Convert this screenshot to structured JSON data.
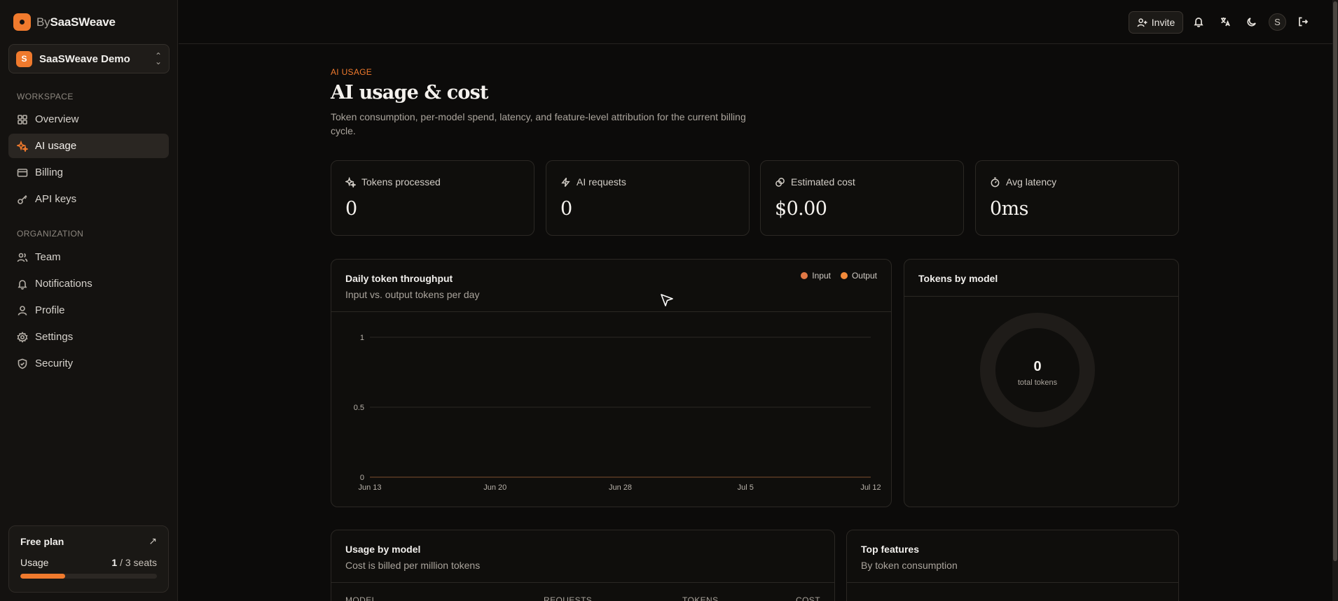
{
  "brand": {
    "prefix": "By",
    "name": "SaaSWeave"
  },
  "workspace": {
    "initial": "S",
    "name": "SaaSWeave Demo"
  },
  "sidebar": {
    "workspace_heading": "WORKSPACE",
    "workspace_items": [
      {
        "label": "Overview",
        "icon": "grid-icon"
      },
      {
        "label": "AI usage",
        "icon": "sparkles-icon",
        "active": true
      },
      {
        "label": "Billing",
        "icon": "credit-card-icon"
      },
      {
        "label": "API keys",
        "icon": "key-icon"
      }
    ],
    "org_heading": "ORGANIZATION",
    "org_items": [
      {
        "label": "Team",
        "icon": "users-icon"
      },
      {
        "label": "Notifications",
        "icon": "bell-icon"
      },
      {
        "label": "Profile",
        "icon": "user-icon"
      },
      {
        "label": "Settings",
        "icon": "gear-icon"
      },
      {
        "label": "Security",
        "icon": "shield-icon"
      }
    ]
  },
  "plan": {
    "title": "Free plan",
    "usage_label": "Usage",
    "seats_used": "1",
    "seats_total": " / 3 seats",
    "usage_fraction": 0.33
  },
  "topbar": {
    "invite_label": "Invite",
    "avatar_initial": "S"
  },
  "header": {
    "eyebrow": "AI USAGE",
    "title": "AI usage & cost",
    "description": "Token consumption, per-model spend, latency, and feature-level attribution for the current billing cycle."
  },
  "stats": [
    {
      "label": "Tokens processed",
      "value": "0",
      "icon": "sparkles-icon"
    },
    {
      "label": "AI requests",
      "value": "0",
      "icon": "bolt-icon"
    },
    {
      "label": "Estimated cost",
      "value": "$0.00",
      "icon": "coins-icon"
    },
    {
      "label": "Avg latency",
      "value": "0ms",
      "icon": "timer-icon"
    }
  ],
  "throughput": {
    "title": "Daily token throughput",
    "subtitle": "Input vs. output tokens per day",
    "legend": [
      {
        "name": "Input",
        "color": "#e07845"
      },
      {
        "name": "Output",
        "color": "#f28a3a"
      }
    ]
  },
  "chart_data": {
    "type": "area",
    "title": "Daily token throughput",
    "x": [
      "Jun 13",
      "Jun 20",
      "Jun 28",
      "Jul 5",
      "Jul 12"
    ],
    "series": [
      {
        "name": "Input",
        "values": [
          0,
          0,
          0,
          0,
          0
        ]
      },
      {
        "name": "Output",
        "values": [
          0,
          0,
          0,
          0,
          0
        ]
      }
    ],
    "y_ticks": [
      "1",
      "0.5",
      "0"
    ],
    "ylim": [
      0,
      1
    ],
    "grid": true,
    "legend_position": "top-right"
  },
  "tokens_by_model": {
    "title": "Tokens by model",
    "total_value": "0",
    "total_label": "total tokens"
  },
  "usage_by_model": {
    "title": "Usage by model",
    "subtitle": "Cost is billed per million tokens",
    "columns": [
      "MODEL",
      "REQUESTS",
      "TOKENS",
      "COST"
    ]
  },
  "top_features": {
    "title": "Top features",
    "subtitle": "By token consumption"
  },
  "colors": {
    "accent": "#f07a2d",
    "background": "#0c0b0a",
    "sidebar": "#141210"
  }
}
